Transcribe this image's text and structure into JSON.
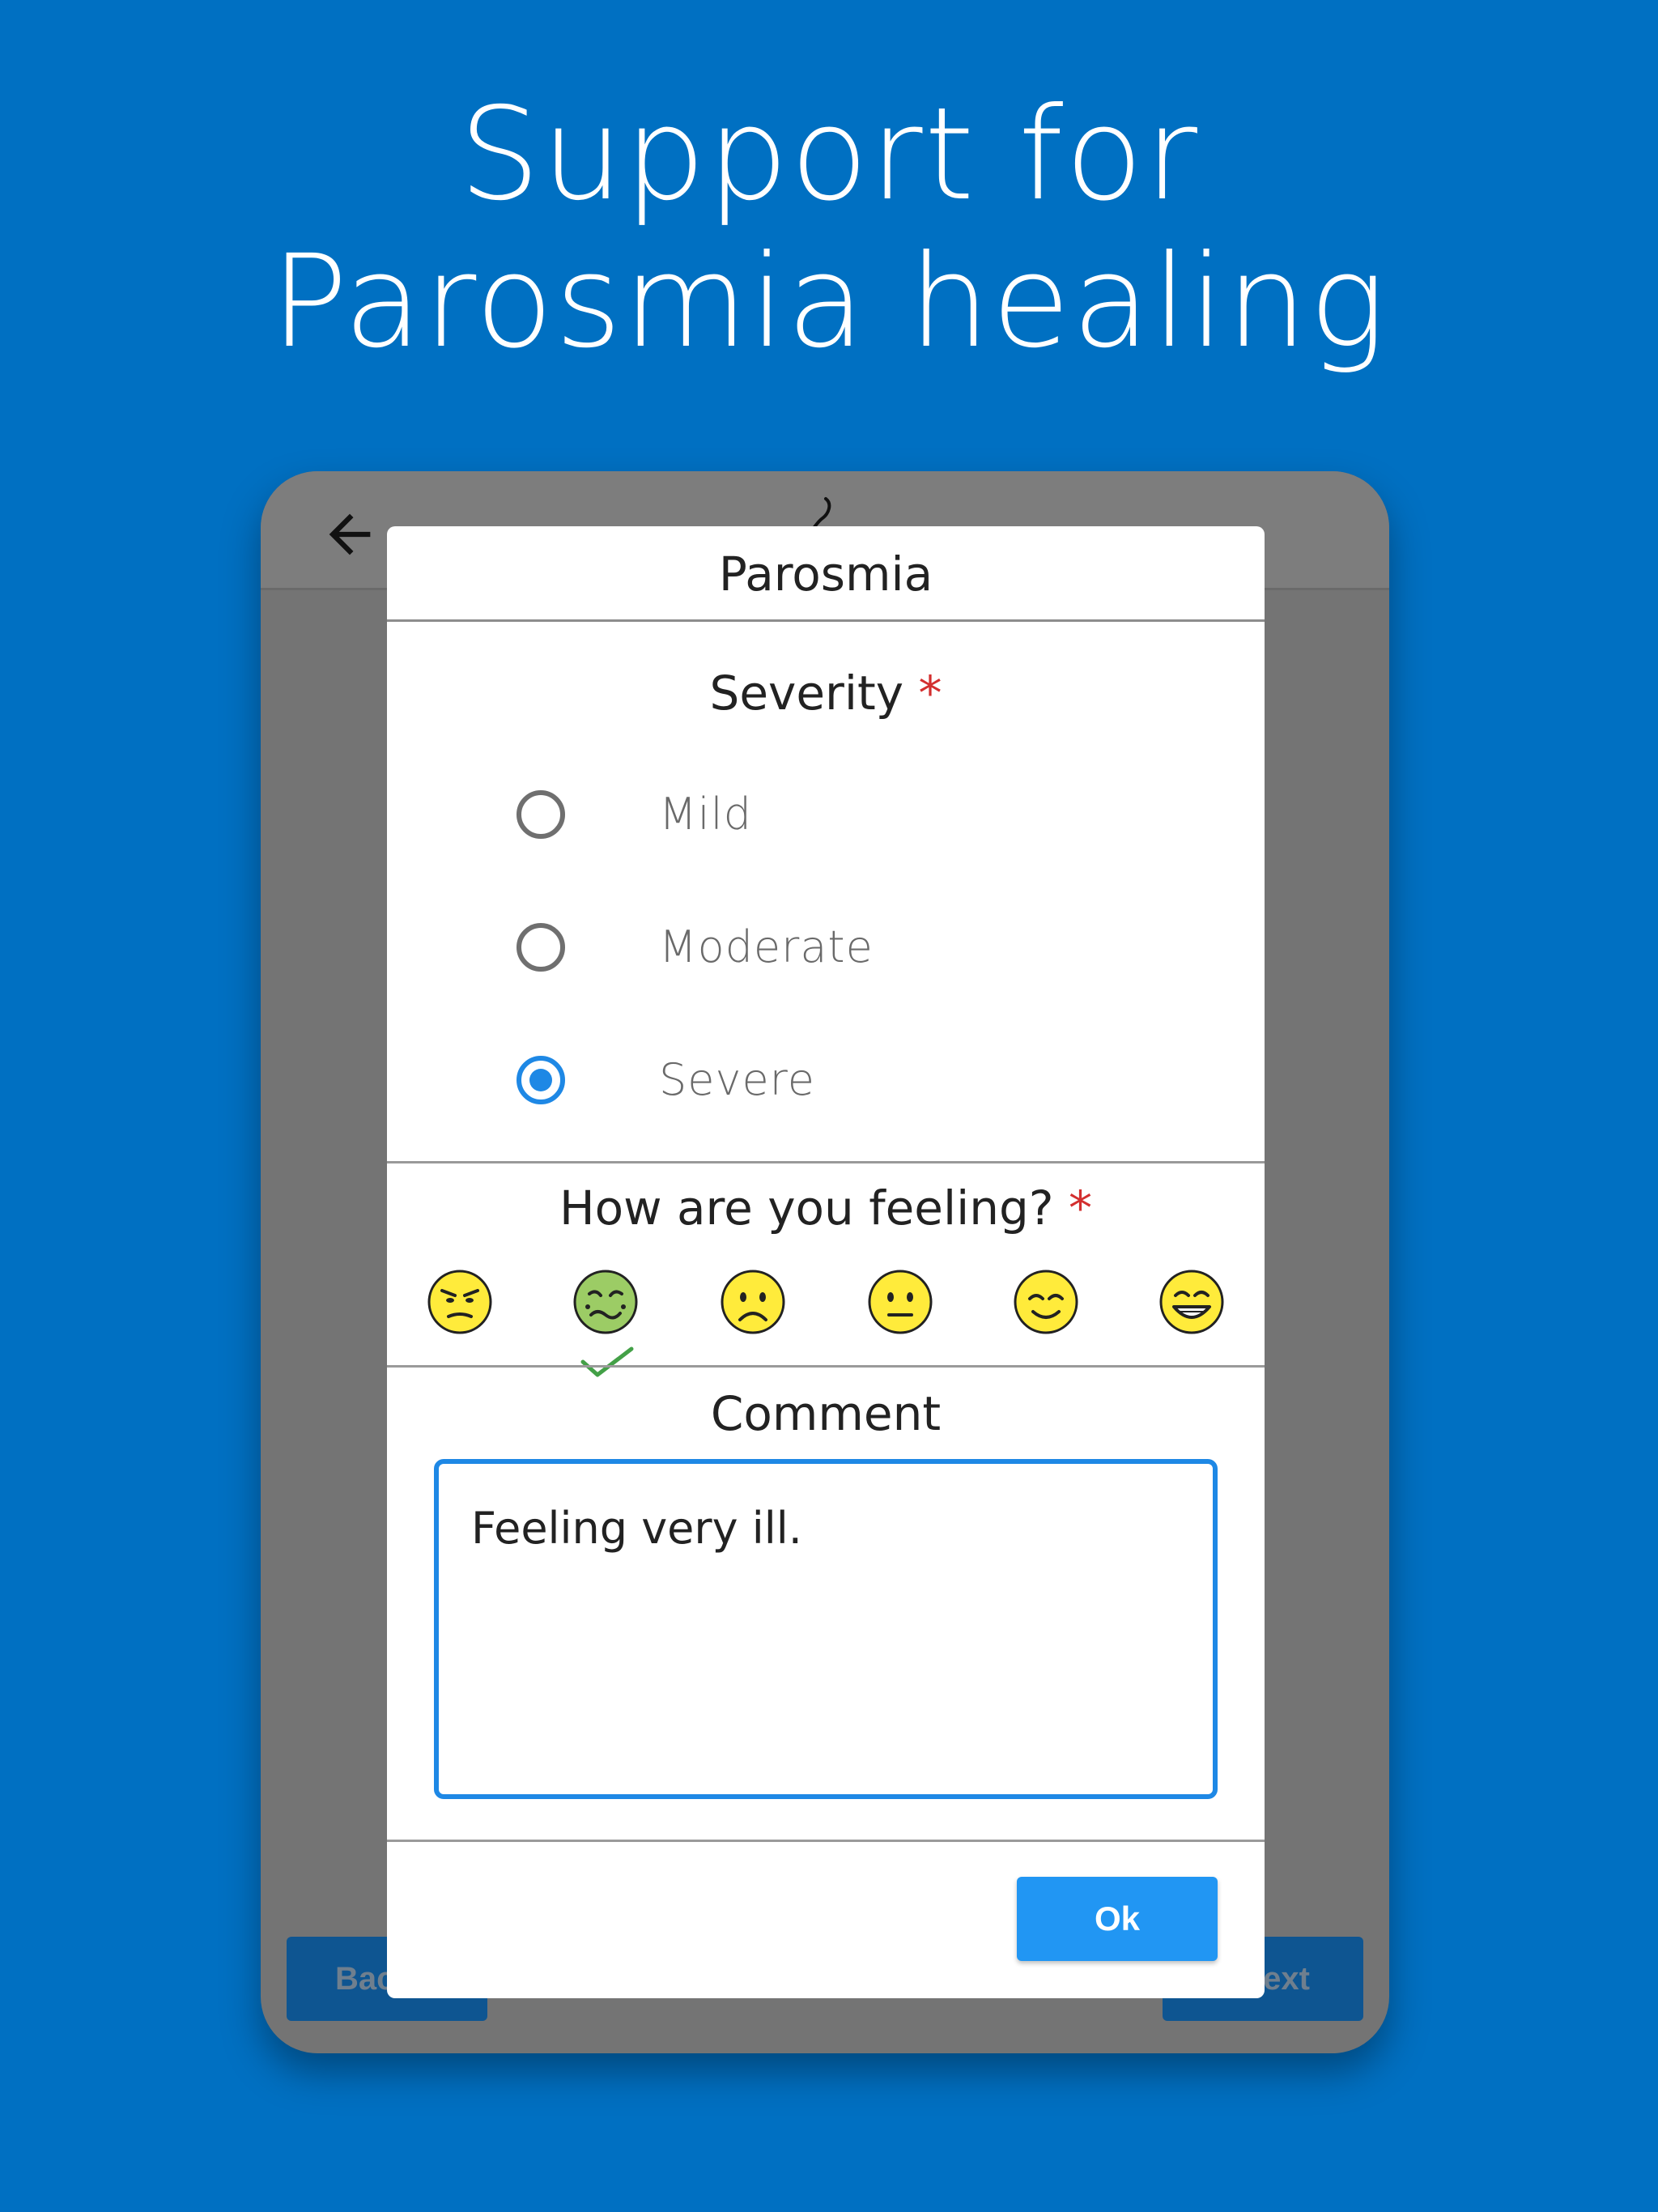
{
  "headline": {
    "line1": "Support for",
    "line2": "Parosmia healing"
  },
  "colors": {
    "background": "#0070c2",
    "accent": "#1e88e5",
    "required": "#d32f2f",
    "selected_check": "#43a047"
  },
  "background_screen": {
    "back_icon": "arrow-left-icon",
    "back_button_label": "Back",
    "next_button_label": "Next"
  },
  "dialog": {
    "title": "Parosmia",
    "severity": {
      "label": "Severity",
      "required_mark": "*",
      "options": [
        {
          "label": "Mild",
          "selected": false
        },
        {
          "label": "Moderate",
          "selected": false
        },
        {
          "label": "Severe",
          "selected": true
        }
      ]
    },
    "feeling": {
      "label": "How are you feeling?",
      "required_mark": "*",
      "options": [
        {
          "icon": "angry-face-icon",
          "selected": false
        },
        {
          "icon": "nauseated-face-icon",
          "selected": true
        },
        {
          "icon": "sad-face-icon",
          "selected": false
        },
        {
          "icon": "neutral-face-icon",
          "selected": false
        },
        {
          "icon": "smiling-face-icon",
          "selected": false
        },
        {
          "icon": "grinning-face-icon",
          "selected": false
        }
      ]
    },
    "comment": {
      "label": "Comment",
      "value": "Feeling very ill."
    },
    "ok_label": "Ok"
  }
}
